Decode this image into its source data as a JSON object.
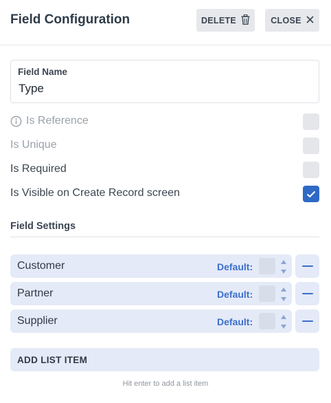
{
  "header": {
    "title": "Field Configuration",
    "delete_label": "DELETE",
    "close_label": "CLOSE"
  },
  "field_name": {
    "label": "Field Name",
    "value": "Type"
  },
  "options": [
    {
      "label": "Is Reference",
      "checked": false,
      "disabled": true,
      "icon": "info-icon"
    },
    {
      "label": "Is Unique",
      "checked": false,
      "disabled": true
    },
    {
      "label": "Is Required",
      "checked": false,
      "disabled": false
    },
    {
      "label": "Is Visible on Create Record screen",
      "checked": true,
      "disabled": false
    }
  ],
  "field_settings": {
    "title": "Field Settings",
    "items": [
      {
        "label": "Customer",
        "default_label": "Default:"
      },
      {
        "label": "Partner",
        "default_label": "Default:"
      },
      {
        "label": "Supplier",
        "default_label": "Default:"
      }
    ],
    "add_label": "ADD LIST ITEM",
    "hint": "Hit enter to add a list item"
  },
  "colors": {
    "accent": "#3c6fcc",
    "checkbox_checked": "#2f69c6",
    "item_bg": "#e4eaf7",
    "button_bg": "#e6e8eb"
  }
}
